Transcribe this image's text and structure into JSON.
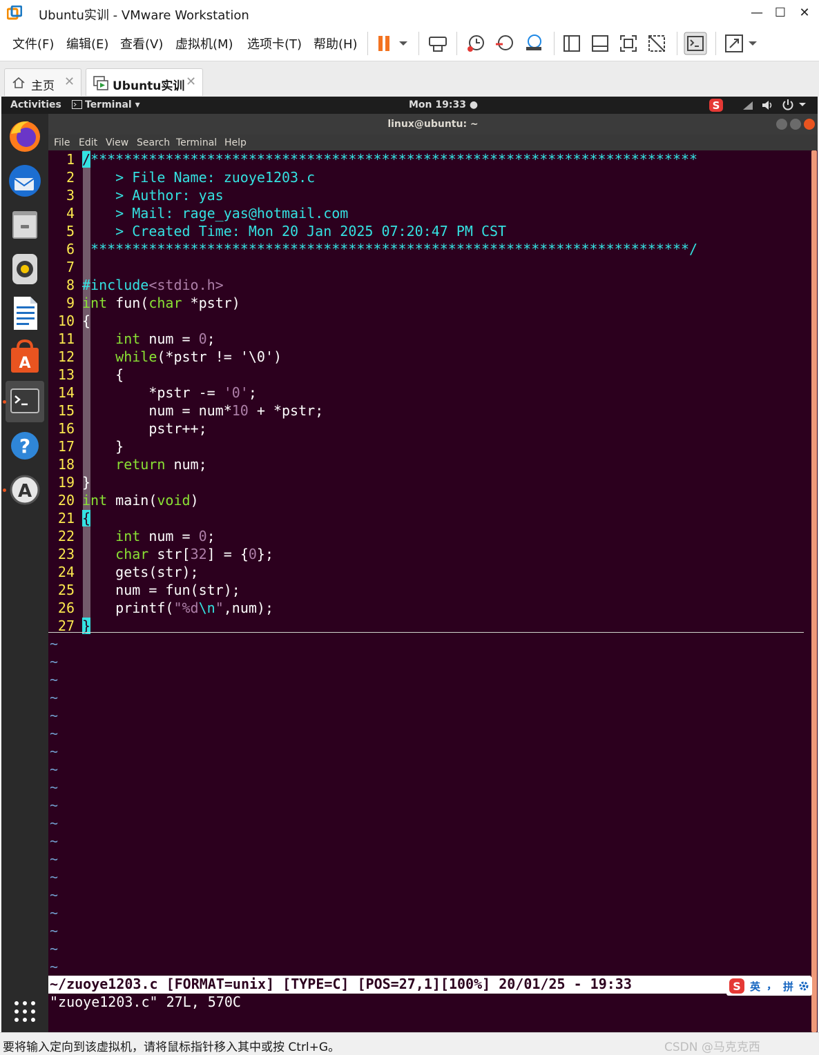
{
  "window": {
    "title": "Ubuntu实训 - VMware Workstation",
    "minimize": "—",
    "maximize": "☐",
    "close": "✕"
  },
  "menu": [
    "文件(F)",
    "编辑(E)",
    "查看(V)",
    "虚拟机(M)",
    "选项卡(T)",
    "帮助(H)"
  ],
  "tabs": [
    {
      "label": "主页",
      "icon": "home-icon"
    },
    {
      "label": "Ubuntu实训",
      "icon": "vm-icon"
    }
  ],
  "gnome": {
    "activities": "Activities",
    "app_menu": "Terminal ▾",
    "clock": "Mon 19:33 ●"
  },
  "terminal": {
    "title": "linux@ubuntu: ~",
    "menu": [
      "File",
      "Edit",
      "View",
      "Search",
      "Terminal",
      "Help"
    ]
  },
  "vim": {
    "lines": [
      "/*************************************************************************",
      "    > File Name: zuoye1203.c",
      "    > Author: yas",
      "    > Mail: rage_yas@hotmail.com",
      "    > Created Time: Mon 20 Jan 2025 07:20:47 PM CST",
      " ************************************************************************/",
      "",
      "#include<stdio.h>",
      "int fun(char *pstr)",
      "{",
      "    int num = 0;",
      "    while(*pstr != '\\0')",
      "    {",
      "        *pstr -= '0';",
      "        num = num*10 + *pstr;",
      "        pstr++;",
      "    }",
      "    return num;",
      "}",
      "int main(void)",
      "{",
      "    int num = 0;",
      "    char str[32] = {0};",
      "    gets(str);",
      "    num = fun(str);",
      "    printf(\"%d\\n\",num);",
      "}"
    ],
    "tilde": "~",
    "statusline": "~/zuoye1203.c [FORMAT=unix] [TYPE=C] [POS=27,1][100%] 20/01/25 - 19:33",
    "message": "\"zuoye1203.c\" 27L, 570C"
  },
  "ime": {
    "lang": "英",
    "punct": "，",
    "mode": "拼"
  },
  "statusbar": {
    "hint": "要将输入定向到该虚拟机，请将鼠标指针移入其中或按 Ctrl+G。",
    "watermark": "CSDN @马克克西"
  },
  "colors": {
    "terminal_bg": "#2c001e",
    "line_number": "#fce94f",
    "comment": "#34e2e2",
    "keyword": "#8ae234",
    "constant": "#ad7fa8",
    "ubuntu_orange": "#e95420"
  }
}
